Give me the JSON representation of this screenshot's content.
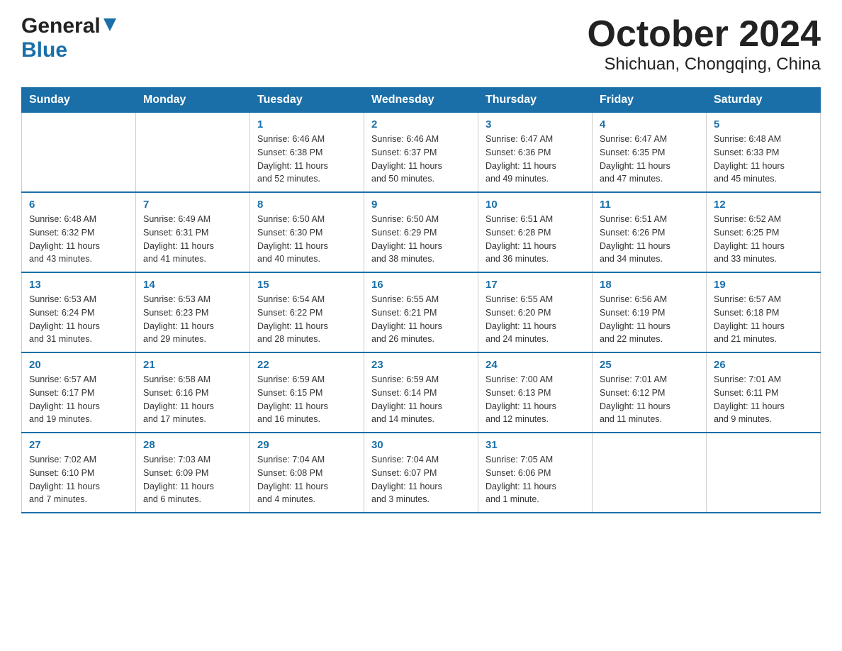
{
  "header": {
    "title": "October 2024",
    "subtitle": "Shichuan, Chongqing, China",
    "logo_general": "General",
    "logo_blue": "Blue"
  },
  "calendar": {
    "days_of_week": [
      "Sunday",
      "Monday",
      "Tuesday",
      "Wednesday",
      "Thursday",
      "Friday",
      "Saturday"
    ],
    "weeks": [
      [
        {
          "day": "",
          "info": ""
        },
        {
          "day": "",
          "info": ""
        },
        {
          "day": "1",
          "info": "Sunrise: 6:46 AM\nSunset: 6:38 PM\nDaylight: 11 hours\nand 52 minutes."
        },
        {
          "day": "2",
          "info": "Sunrise: 6:46 AM\nSunset: 6:37 PM\nDaylight: 11 hours\nand 50 minutes."
        },
        {
          "day": "3",
          "info": "Sunrise: 6:47 AM\nSunset: 6:36 PM\nDaylight: 11 hours\nand 49 minutes."
        },
        {
          "day": "4",
          "info": "Sunrise: 6:47 AM\nSunset: 6:35 PM\nDaylight: 11 hours\nand 47 minutes."
        },
        {
          "day": "5",
          "info": "Sunrise: 6:48 AM\nSunset: 6:33 PM\nDaylight: 11 hours\nand 45 minutes."
        }
      ],
      [
        {
          "day": "6",
          "info": "Sunrise: 6:48 AM\nSunset: 6:32 PM\nDaylight: 11 hours\nand 43 minutes."
        },
        {
          "day": "7",
          "info": "Sunrise: 6:49 AM\nSunset: 6:31 PM\nDaylight: 11 hours\nand 41 minutes."
        },
        {
          "day": "8",
          "info": "Sunrise: 6:50 AM\nSunset: 6:30 PM\nDaylight: 11 hours\nand 40 minutes."
        },
        {
          "day": "9",
          "info": "Sunrise: 6:50 AM\nSunset: 6:29 PM\nDaylight: 11 hours\nand 38 minutes."
        },
        {
          "day": "10",
          "info": "Sunrise: 6:51 AM\nSunset: 6:28 PM\nDaylight: 11 hours\nand 36 minutes."
        },
        {
          "day": "11",
          "info": "Sunrise: 6:51 AM\nSunset: 6:26 PM\nDaylight: 11 hours\nand 34 minutes."
        },
        {
          "day": "12",
          "info": "Sunrise: 6:52 AM\nSunset: 6:25 PM\nDaylight: 11 hours\nand 33 minutes."
        }
      ],
      [
        {
          "day": "13",
          "info": "Sunrise: 6:53 AM\nSunset: 6:24 PM\nDaylight: 11 hours\nand 31 minutes."
        },
        {
          "day": "14",
          "info": "Sunrise: 6:53 AM\nSunset: 6:23 PM\nDaylight: 11 hours\nand 29 minutes."
        },
        {
          "day": "15",
          "info": "Sunrise: 6:54 AM\nSunset: 6:22 PM\nDaylight: 11 hours\nand 28 minutes."
        },
        {
          "day": "16",
          "info": "Sunrise: 6:55 AM\nSunset: 6:21 PM\nDaylight: 11 hours\nand 26 minutes."
        },
        {
          "day": "17",
          "info": "Sunrise: 6:55 AM\nSunset: 6:20 PM\nDaylight: 11 hours\nand 24 minutes."
        },
        {
          "day": "18",
          "info": "Sunrise: 6:56 AM\nSunset: 6:19 PM\nDaylight: 11 hours\nand 22 minutes."
        },
        {
          "day": "19",
          "info": "Sunrise: 6:57 AM\nSunset: 6:18 PM\nDaylight: 11 hours\nand 21 minutes."
        }
      ],
      [
        {
          "day": "20",
          "info": "Sunrise: 6:57 AM\nSunset: 6:17 PM\nDaylight: 11 hours\nand 19 minutes."
        },
        {
          "day": "21",
          "info": "Sunrise: 6:58 AM\nSunset: 6:16 PM\nDaylight: 11 hours\nand 17 minutes."
        },
        {
          "day": "22",
          "info": "Sunrise: 6:59 AM\nSunset: 6:15 PM\nDaylight: 11 hours\nand 16 minutes."
        },
        {
          "day": "23",
          "info": "Sunrise: 6:59 AM\nSunset: 6:14 PM\nDaylight: 11 hours\nand 14 minutes."
        },
        {
          "day": "24",
          "info": "Sunrise: 7:00 AM\nSunset: 6:13 PM\nDaylight: 11 hours\nand 12 minutes."
        },
        {
          "day": "25",
          "info": "Sunrise: 7:01 AM\nSunset: 6:12 PM\nDaylight: 11 hours\nand 11 minutes."
        },
        {
          "day": "26",
          "info": "Sunrise: 7:01 AM\nSunset: 6:11 PM\nDaylight: 11 hours\nand 9 minutes."
        }
      ],
      [
        {
          "day": "27",
          "info": "Sunrise: 7:02 AM\nSunset: 6:10 PM\nDaylight: 11 hours\nand 7 minutes."
        },
        {
          "day": "28",
          "info": "Sunrise: 7:03 AM\nSunset: 6:09 PM\nDaylight: 11 hours\nand 6 minutes."
        },
        {
          "day": "29",
          "info": "Sunrise: 7:04 AM\nSunset: 6:08 PM\nDaylight: 11 hours\nand 4 minutes."
        },
        {
          "day": "30",
          "info": "Sunrise: 7:04 AM\nSunset: 6:07 PM\nDaylight: 11 hours\nand 3 minutes."
        },
        {
          "day": "31",
          "info": "Sunrise: 7:05 AM\nSunset: 6:06 PM\nDaylight: 11 hours\nand 1 minute."
        },
        {
          "day": "",
          "info": ""
        },
        {
          "day": "",
          "info": ""
        }
      ]
    ]
  }
}
